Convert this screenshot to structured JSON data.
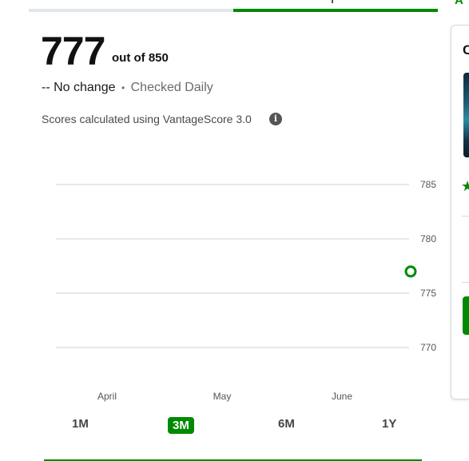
{
  "top_tabs": {
    "peek_label": "A"
  },
  "score": {
    "value": "777",
    "out_of": "out of 850",
    "change": "-- No change",
    "separator": "•",
    "frequency": "Checked Daily",
    "model_note": "Scores calculated using VantageScore 3.0",
    "info_icon": "i"
  },
  "chart_data": {
    "type": "line",
    "x_labels": [
      "April",
      "May",
      "June"
    ],
    "y_ticks": [
      785,
      780,
      775,
      770
    ],
    "ylim": [
      770,
      785
    ],
    "grid": true,
    "series": [
      {
        "points": [
          {
            "x": "late June",
            "y": 777
          }
        ],
        "color": "#008a00"
      }
    ]
  },
  "ranges": {
    "items": [
      "1M",
      "3M",
      "6M",
      "1Y"
    ],
    "selected": "3M"
  },
  "side_panel": {
    "letter": "C",
    "star": "★"
  },
  "colors": {
    "accent": "#008a00",
    "grid": "#d0d0d0",
    "muted_text": "#6b6b6b"
  }
}
